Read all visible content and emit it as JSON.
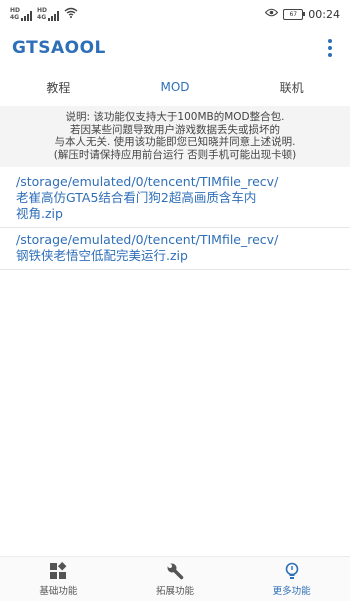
{
  "status_bar": {
    "sim1_label": "HD",
    "sim1_type": "4G",
    "sim2_label": "HD",
    "sim2_type": "4G",
    "battery": "67",
    "time": "00:24"
  },
  "app_bar": {
    "title": "GTSAOOL"
  },
  "tabs": [
    {
      "label": "教程",
      "active": false
    },
    {
      "label": "MOD",
      "active": true
    },
    {
      "label": "联机",
      "active": false
    }
  ],
  "notice": {
    "lines": [
      "说明: 该功能仅支持大于100MB的MOD整合包.",
      "若因某些问题导致用户游戏数据丢失或损坏的",
      "与本人无关. 使用该功能即您已知晓并同意上述说明.",
      "(解压时请保持应用前台运行 否则手机可能出现卡顿)"
    ]
  },
  "files": [
    {
      "lines": [
        "/storage/emulated/0/tencent/TIMfile_recv/",
        "老崔高仿GTA5结合看门狗2超高画质含车内",
        "视角.zip"
      ]
    },
    {
      "lines": [
        "/storage/emulated/0/tencent/TIMfile_recv/",
        "钢铁侠老悟空低配完美运行.zip"
      ]
    }
  ],
  "bottom_nav": [
    {
      "label": "基础功能",
      "icon": "apps-icon",
      "active": false
    },
    {
      "label": "拓展功能",
      "icon": "wrench-icon",
      "active": false
    },
    {
      "label": "更多功能",
      "icon": "bulb-icon",
      "active": true
    }
  ],
  "colors": {
    "accent": "#2f6fb8",
    "notice_bg": "#f4f4f4"
  }
}
